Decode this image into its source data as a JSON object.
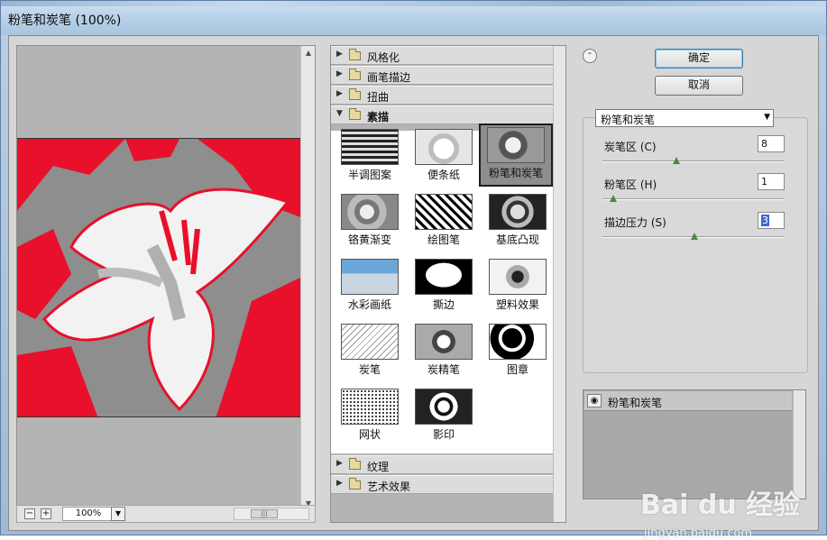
{
  "window": {
    "title": "粉笔和炭笔 (100%)"
  },
  "preview": {
    "zoom": "100%"
  },
  "gallery": {
    "categories_top": [
      "风格化",
      "画笔描边",
      "扭曲"
    ],
    "open_category": "素描",
    "categories_bottom": [
      "纹理",
      "艺术效果"
    ],
    "filters": [
      "半调图案",
      "便条纸",
      "粉笔和炭笔",
      "铬黄渐变",
      "绘图笔",
      "基底凸现",
      "水彩画纸",
      "撕边",
      "塑料效果",
      "炭笔",
      "炭精笔",
      "图章",
      "网状",
      "影印"
    ],
    "selected_filter": "粉笔和炭笔"
  },
  "buttons": {
    "ok": "确定",
    "cancel": "取消"
  },
  "settings": {
    "filter_select": "粉笔和炭笔",
    "params": [
      {
        "label": "炭笔区 (C)",
        "value": "8"
      },
      {
        "label": "粉笔区 (H)",
        "value": "1"
      },
      {
        "label": "描边压力 (S)",
        "value": "3"
      }
    ]
  },
  "layers": {
    "items": [
      "粉笔和炭笔"
    ]
  },
  "watermark": {
    "brand": "Bai du 经验",
    "url": "jingyan.baidu.com"
  },
  "colors": {
    "accent_red": "#e8102a",
    "panel_gray": "#b4b4b4",
    "knob_green": "#4a8a3d"
  }
}
